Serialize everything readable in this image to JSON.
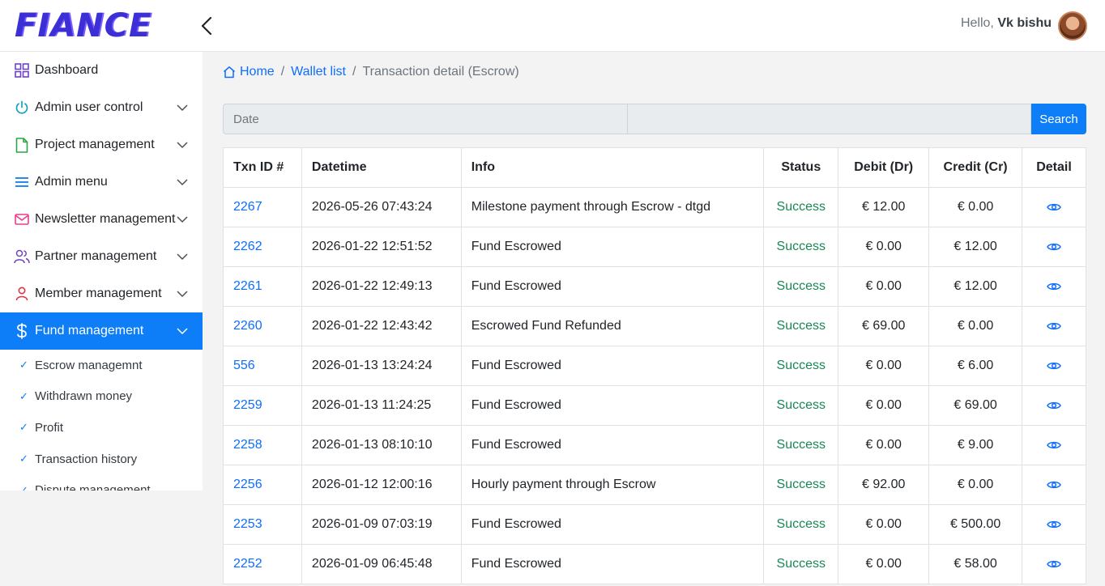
{
  "header": {
    "logo_text": "FIANCE",
    "greeting": "Hello,",
    "user_name": "Vk bishu"
  },
  "breadcrumb": {
    "home": "Home",
    "wallet": "Wallet list",
    "current": "Transaction detail (Escrow)"
  },
  "sidebar": {
    "items": [
      {
        "label": "Dashboard",
        "icon": "grid-icon"
      },
      {
        "label": "Admin user control",
        "icon": "power-icon"
      },
      {
        "label": "Project management",
        "icon": "file-icon"
      },
      {
        "label": "Admin menu",
        "icon": "menu-icon"
      },
      {
        "label": "Newsletter management",
        "icon": "mail-icon"
      },
      {
        "label": "Partner management",
        "icon": "users-icon"
      },
      {
        "label": "Member management",
        "icon": "user-icon"
      },
      {
        "label": "Fund management",
        "icon": "dollar-icon"
      }
    ],
    "sub_items": [
      {
        "label": "Escrow managemnt"
      },
      {
        "label": "Withdrawn money"
      },
      {
        "label": "Profit"
      },
      {
        "label": "Transaction history"
      },
      {
        "label": "Dispute management"
      }
    ]
  },
  "search": {
    "date_placeholder": "Date",
    "text_placeholder": "",
    "button_label": "Search"
  },
  "table": {
    "headers": [
      "Txn ID #",
      "Datetime",
      "Info",
      "Status",
      "Debit (Dr)",
      "Credit (Cr)",
      "Detail"
    ],
    "rows": [
      {
        "id": "2267",
        "datetime": "2026-05-26 07:43:24",
        "info": "Milestone payment through Escrow - dtgd",
        "status": "Success",
        "debit": "€ 12.00",
        "credit": "€ 0.00"
      },
      {
        "id": "2262",
        "datetime": "2026-01-22 12:51:52",
        "info": "Fund Escrowed",
        "status": "Success",
        "debit": "€ 0.00",
        "credit": "€ 12.00"
      },
      {
        "id": "2261",
        "datetime": "2026-01-22 12:49:13",
        "info": "Fund Escrowed",
        "status": "Success",
        "debit": "€ 0.00",
        "credit": "€ 12.00"
      },
      {
        "id": "2260",
        "datetime": "2026-01-22 12:43:42",
        "info": "Escrowed Fund Refunded",
        "status": "Success",
        "debit": "€ 69.00",
        "credit": "€ 0.00"
      },
      {
        "id": "556",
        "datetime": "2026-01-13 13:24:24",
        "info": "Fund Escrowed",
        "status": "Success",
        "debit": "€ 0.00",
        "credit": "€ 6.00"
      },
      {
        "id": "2259",
        "datetime": "2026-01-13 11:24:25",
        "info": "Fund Escrowed",
        "status": "Success",
        "debit": "€ 0.00",
        "credit": "€ 69.00"
      },
      {
        "id": "2258",
        "datetime": "2026-01-13 08:10:10",
        "info": "Fund Escrowed",
        "status": "Success",
        "debit": "€ 0.00",
        "credit": "€ 9.00"
      },
      {
        "id": "2256",
        "datetime": "2026-01-12 12:00:16",
        "info": "Hourly payment through Escrow",
        "status": "Success",
        "debit": "€ 92.00",
        "credit": "€ 0.00"
      },
      {
        "id": "2253",
        "datetime": "2026-01-09 07:03:19",
        "info": "Fund Escrowed",
        "status": "Success",
        "debit": "€ 0.00",
        "credit": "€ 500.00"
      },
      {
        "id": "2252",
        "datetime": "2026-01-09 06:45:48",
        "info": "Fund Escrowed",
        "status": "Success",
        "debit": "€ 0.00",
        "credit": "€ 58.00"
      }
    ]
  },
  "colors": {
    "accent": "#0d7ef7",
    "link": "#0d6efd",
    "success": "#198754",
    "logo": "#3d2fd6"
  }
}
